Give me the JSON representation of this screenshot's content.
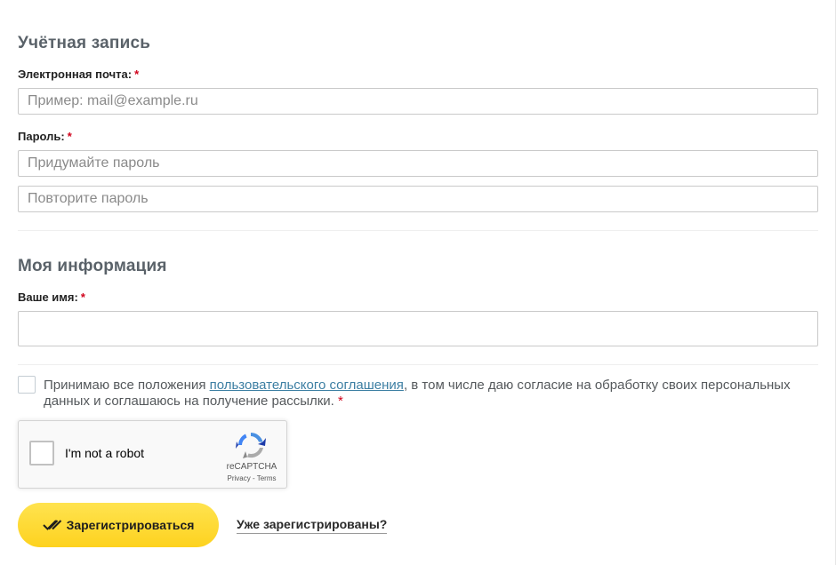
{
  "account": {
    "title": "Учётная запись",
    "email_label": "Электронная почта:",
    "email_placeholder": "Пример: mail@example.ru",
    "email_value": "",
    "password_label": "Пароль:",
    "password_placeholder": "Придумайте пароль",
    "password_repeat_placeholder": "Повторите пароль",
    "required_mark": "*"
  },
  "info": {
    "title": "Моя информация",
    "name_label": "Ваше имя:",
    "name_value": "",
    "required_mark": "*"
  },
  "consent": {
    "checked": false,
    "text_before": "Принимаю все положения ",
    "link_text": "пользовательского соглашения",
    "text_after": ", в том числе даю согласие на обработку своих персональных данных и соглашаюсь на получение рассылки. ",
    "required_mark": "*"
  },
  "recaptcha": {
    "label": "I'm not a robot",
    "brand": "reCAPTCHA",
    "privacy": "Privacy",
    "separator": " - ",
    "terms": "Terms"
  },
  "actions": {
    "submit_label": "Зарегистрироваться",
    "login_link": "Уже зарегистрированы?"
  },
  "colors": {
    "accent_yellow": "#fdd21f",
    "link_blue": "#3d7fa3",
    "required_red": "#d0021b"
  },
  "icons": {
    "submit_icon": "double-check-icon",
    "recaptcha_logo": "recaptcha-logo-icon"
  }
}
